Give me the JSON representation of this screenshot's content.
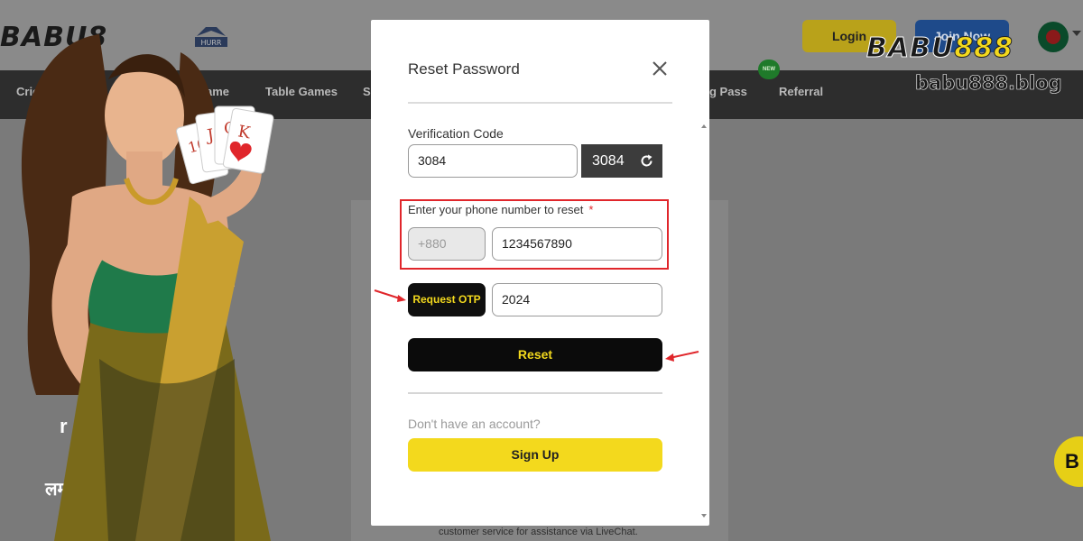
{
  "site": {
    "logo_text": "BABU8",
    "login_label": "Login",
    "join_label": "Join Now",
    "nav": {
      "cricket": "Cricket",
      "games_partial": "ame",
      "table_games": "Table Games",
      "s_partial": "S",
      "pass_partial": "g Pass",
      "referral": "Referral",
      "new_badge": "NEW"
    },
    "support_text": "customer service for assistance via LiveChat.",
    "promo_line_1": "r",
    "promo_line_2": "लमा!",
    "chat_bubble": "B"
  },
  "watermark": {
    "logo_a": "BABU",
    "logo_b": "888",
    "url": "babu888.blog"
  },
  "modal": {
    "title": "Reset Password",
    "verification_label": "Verification Code",
    "verification_value": "3084",
    "captcha_code": "3084",
    "phone_label": "Enter your phone number to reset",
    "required_mark": "*",
    "country_prefix": "+880",
    "phone_value": "1234567890",
    "otp_button": "Request OTP",
    "otp_value": "2024",
    "reset_button": "Reset",
    "no_account_text": "Don't have an account?",
    "signup_button": "Sign Up"
  },
  "colors": {
    "accent_yellow": "#f3d91d",
    "annotation_red": "#e0262b",
    "button_dark": "#0b0b0b"
  }
}
